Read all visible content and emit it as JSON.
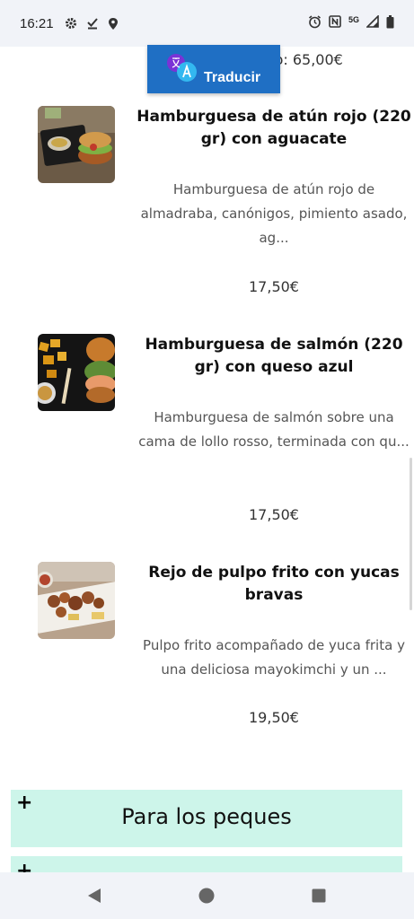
{
  "status_bar": {
    "time": "16:21",
    "network": "5G",
    "icons": [
      "gear-icon",
      "download-done-icon",
      "location-icon",
      "alarm-icon",
      "nfc-icon",
      "signal-icon",
      "battery-icon"
    ]
  },
  "translate": {
    "label": "Traducir",
    "icon": "translate-icon"
  },
  "top_price": "mo: 65,00€",
  "items": [
    {
      "title": "Hamburguesa de atún rojo (220 gr) con aguacate",
      "description": "Hamburguesa de atún rojo de almadraba, canónigos, pimiento asado, ag...",
      "price": "17,50€"
    },
    {
      "title": "Hamburguesa de salmón (220 gr) con queso azul",
      "description": "Hamburguesa de salmón sobre una cama de lollo rosso, terminada con qu...",
      "price": "17,50€"
    },
    {
      "title": "Rejo de pulpo frito con yucas bravas",
      "description": "Pulpo frito acompañado de yuca frita y una deliciosa mayokimchi y un ...",
      "price": "19,50€"
    }
  ],
  "sections": [
    {
      "plus": "+",
      "title": "Para los peques"
    },
    {
      "plus": "+",
      "title": ""
    }
  ],
  "colors": {
    "translate_bg": "#1f6fc4",
    "section_bg": "#cdf5ea",
    "bars_bg": "#f1f3f8"
  }
}
